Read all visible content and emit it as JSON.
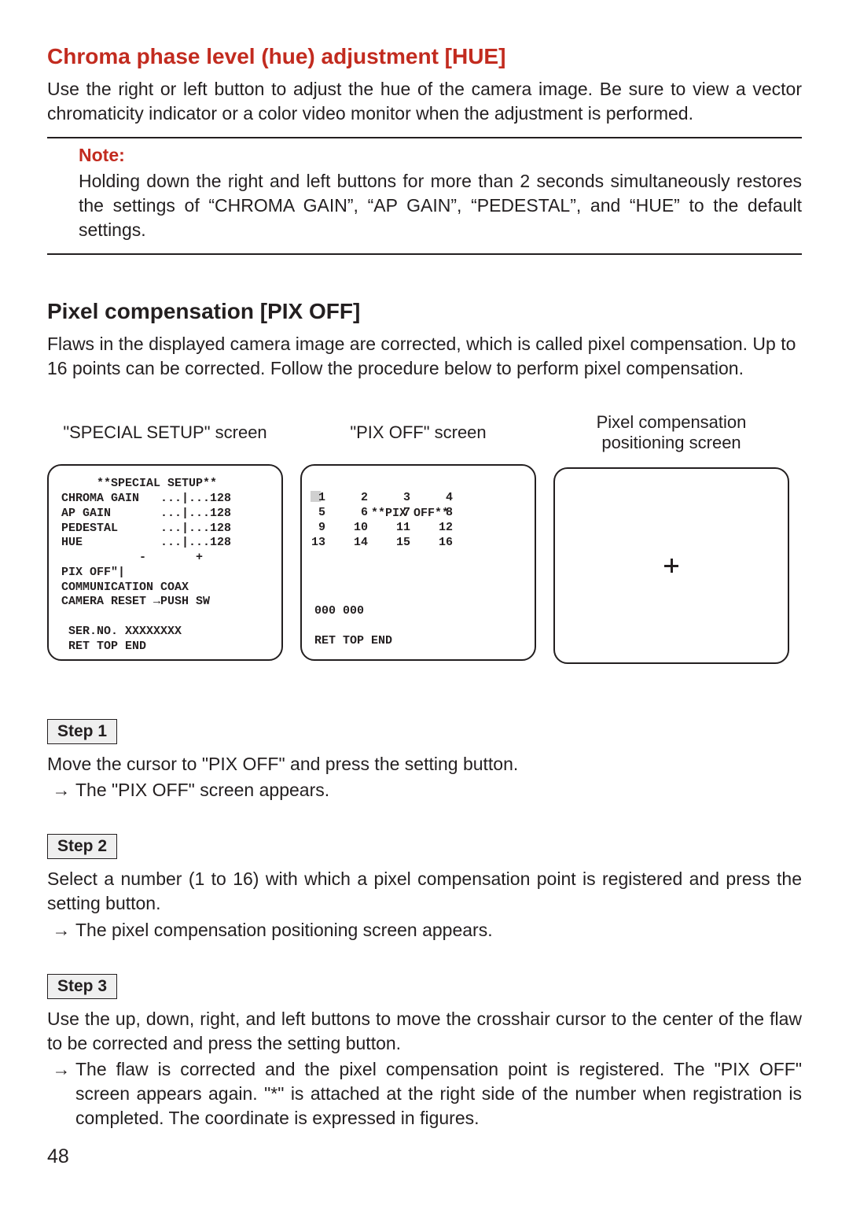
{
  "hue": {
    "title": "Chroma phase level (hue) adjustment [HUE]",
    "body": "Use the right or left button to adjust the hue of the camera image. Be sure to view a vector chromaticity indicator or a color video monitor when the adjustment is performed."
  },
  "note": {
    "label": "Note:",
    "text": "Holding down the right and left buttons for more than 2 seconds simultaneously restores the settings of “CHROMA GAIN”, “AP GAIN”, “PEDESTAL”, and “HUE” to the default settings."
  },
  "pix": {
    "title": "Pixel compensation [PIX OFF]",
    "body": "Flaws in the displayed camera image are corrected, which is called pixel compensation. Up to 16 points can be corrected. Follow the procedure below to perform pixel compensation."
  },
  "screens": {
    "special_caption": "\"SPECIAL SETUP\" screen",
    "pixoff_caption": "\"PIX OFF\" screen",
    "pos_caption": "Pixel compensation positioning screen",
    "osd_special": "     **SPECIAL SETUP**\nCHROMA GAIN   ...|...128\nAP GAIN       ...|...128\nPEDESTAL      ...|...128\nHUE           ...|...128\n           -       +\nPIX OFF\"|\nCOMMUNICATION COAX\nCAMERA RESET →PUSH SW\n\n SER.NO. XXXXXXXX\n RET TOP END",
    "osd_pixoff_title": "        **PIX OFF**",
    "osd_pixoff_grid": " 1     2     3     4\n 5     6     7     8\n 9    10    11    12\n13    14    15    16",
    "osd_pixoff_footer": "000 000\n\nRET TOP END"
  },
  "steps": {
    "s1_label": "Step 1",
    "s1_body": "Move the cursor to \"PIX OFF\" and press the setting button.",
    "s1_arrow": "The \"PIX OFF\" screen appears.",
    "s2_label": "Step 2",
    "s2_body": "Select a number (1 to 16) with which a pixel compensation point is registered and press the setting button.",
    "s2_arrow": "The pixel compensation positioning screen appears.",
    "s3_label": "Step 3",
    "s3_body": "Use the up, down, right, and left buttons to move the crosshair cursor to the center of the flaw to be corrected and press the setting button.",
    "s3_arrow": "The flaw is corrected and the pixel compensation point is registered. The \"PIX OFF\" screen appears again. \"*\" is attached at the right side of the number when registration is completed. The coordinate is expressed in figures."
  },
  "arrow_glyph": "→",
  "page_number": "48"
}
